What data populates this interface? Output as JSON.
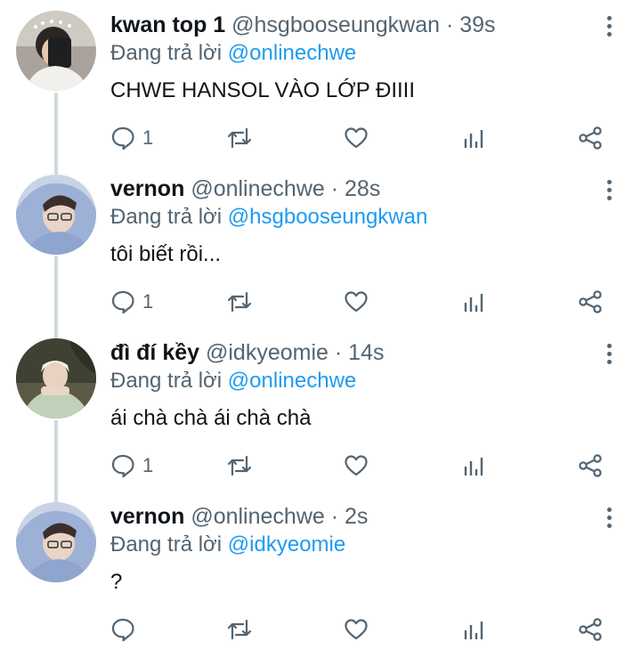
{
  "tweets": [
    {
      "name": "kwan top 1",
      "handle": "@hsgbooseungkwan",
      "separator": "·",
      "time": "39s",
      "replying_prefix": "Đang trả lời",
      "replying_to": "@onlinechwe",
      "text": "CHWE HANSOL VÀO LỚP ĐIIII",
      "reply_count": "1"
    },
    {
      "name": "vernon",
      "handle": "@onlinechwe",
      "separator": "·",
      "time": "28s",
      "replying_prefix": "Đang trả lời",
      "replying_to": "@hsgbooseungkwan",
      "text": "tôi biết rồi...",
      "reply_count": "1"
    },
    {
      "name": "đì đí kềy",
      "handle": "@idkyeomie",
      "separator": "·",
      "time": "14s",
      "replying_prefix": "Đang trả lời",
      "replying_to": "@onlinechwe",
      "text": "ái chà chà ái chà chà",
      "reply_count": "1"
    },
    {
      "name": "vernon",
      "handle": "@onlinechwe",
      "separator": "·",
      "time": "2s",
      "replying_prefix": "Đang trả lời",
      "replying_to": "@idkyeomie",
      "text": "?",
      "reply_count": ""
    }
  ],
  "icons": {
    "reply": "reply-icon",
    "retweet": "retweet-icon",
    "like": "heart-icon",
    "views": "views-icon",
    "share": "share-icon",
    "more": "more-icon"
  },
  "colors": {
    "text": "#0f1419",
    "secondary": "#536471",
    "mention": "#1d9bf0",
    "thread_line": "#cfd9de"
  }
}
